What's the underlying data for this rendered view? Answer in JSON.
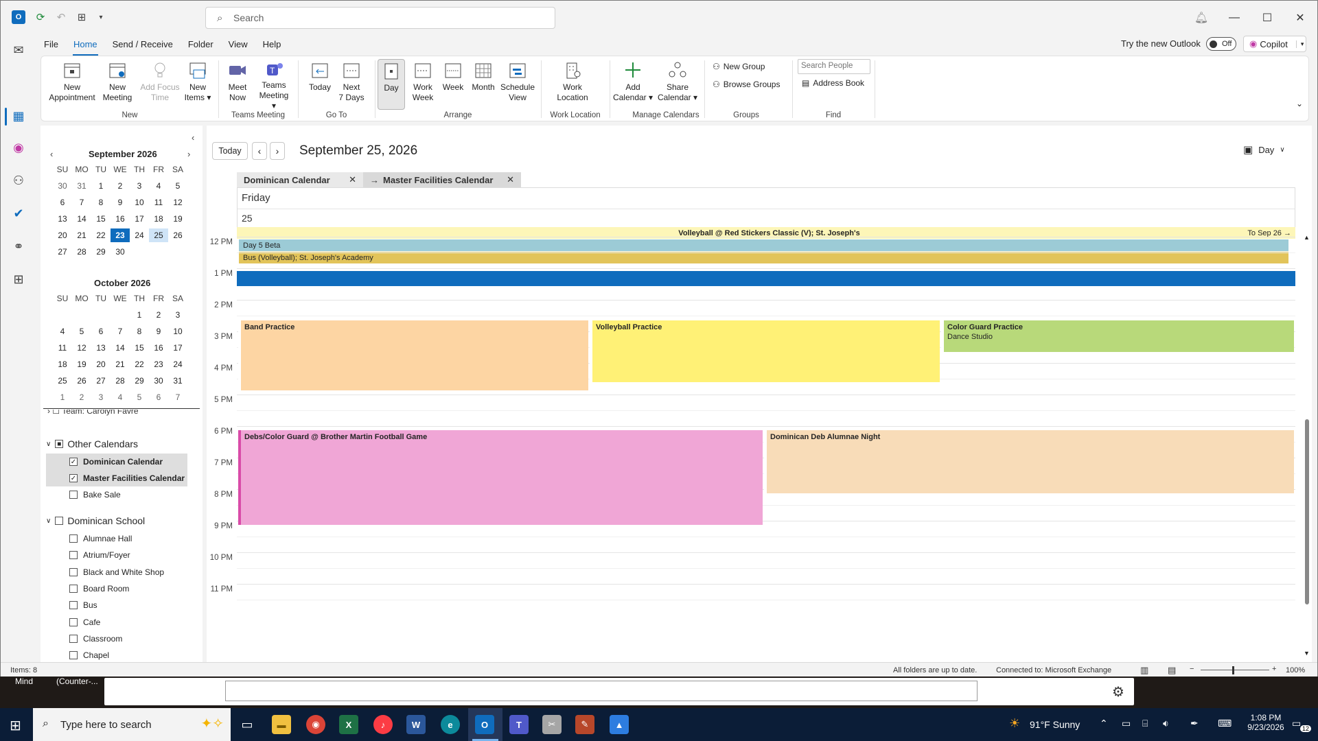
{
  "search": {
    "placeholder": "Search"
  },
  "menu": {
    "tabs": [
      "File",
      "Home",
      "Send / Receive",
      "Folder",
      "View",
      "Help"
    ]
  },
  "header_right": {
    "try_new": "Try the new Outlook",
    "toggle": "Off",
    "copilot": "Copilot"
  },
  "ribbon": {
    "new_appointment": [
      "New",
      "Appointment"
    ],
    "new_meeting": [
      "New",
      "Meeting"
    ],
    "add_focus_time": [
      "Add Focus",
      "Time"
    ],
    "new_items": [
      "New",
      "Items"
    ],
    "meet_now": [
      "Meet",
      "Now"
    ],
    "teams_meeting": [
      "Teams",
      "Meeting"
    ],
    "today": [
      "Today"
    ],
    "next7": [
      "Next",
      "7 Days"
    ],
    "day": [
      "Day"
    ],
    "work_week": [
      "Work",
      "Week"
    ],
    "week": [
      "Week"
    ],
    "month": [
      "Month"
    ],
    "schedule_view": [
      "Schedule",
      "View"
    ],
    "work_location": [
      "Work",
      "Location"
    ],
    "add_calendar": [
      "Add",
      "Calendar"
    ],
    "share_calendar": [
      "Share",
      "Calendar"
    ],
    "new_group": "New Group",
    "browse_groups": "Browse Groups",
    "search_people": "Search People",
    "address_book": "Address Book",
    "groups": {
      "new": "New",
      "teams": "Teams Meeting",
      "goto": "Go To",
      "arrange": "Arrange",
      "work_location": "Work Location",
      "manage": "Manage Calendars",
      "groups": "Groups",
      "find": "Find"
    }
  },
  "minical": {
    "dow": [
      "SU",
      "MO",
      "TU",
      "WE",
      "TH",
      "FR",
      "SA"
    ],
    "sept": {
      "title": "September 2026",
      "days": [
        "30",
        "31",
        "1",
        "2",
        "3",
        "4",
        "5",
        "6",
        "7",
        "8",
        "9",
        "10",
        "11",
        "12",
        "13",
        "14",
        "15",
        "16",
        "17",
        "18",
        "19",
        "20",
        "21",
        "22",
        "23",
        "24",
        "25",
        "26",
        "27",
        "28",
        "29",
        "30"
      ]
    },
    "oct": {
      "title": "October 2026",
      "days": [
        "",
        "",
        "",
        "",
        "1",
        "2",
        "3",
        "4",
        "5",
        "6",
        "7",
        "8",
        "9",
        "10",
        "11",
        "12",
        "13",
        "14",
        "15",
        "16",
        "17",
        "18",
        "19",
        "20",
        "21",
        "22",
        "23",
        "24",
        "25",
        "26",
        "27",
        "28",
        "29",
        "30",
        "31",
        "1",
        "2",
        "3",
        "4",
        "5",
        "6",
        "7"
      ]
    }
  },
  "folders": {
    "partial": "Team: Carolyn Favre",
    "other_calendars": "Other Calendars",
    "other_items": [
      {
        "label": "Dominican Calendar",
        "checked": true
      },
      {
        "label": "Master Facilities Calendar",
        "checked": true
      },
      {
        "label": "Bake Sale",
        "checked": false
      }
    ],
    "dominican_school": "Dominican School",
    "school_items": [
      "Alumnae Hall",
      "Atrium/Foyer",
      "Black and White Shop",
      "Board Room",
      "Bus",
      "Cafe",
      "Classroom",
      "Chapel"
    ]
  },
  "dayview": {
    "today_btn": "Today",
    "date_title": "September 25, 2026",
    "view": "Day",
    "tabs": [
      "Dominican Calendar",
      "Master Facilities Calendar"
    ],
    "day_name": "Friday",
    "day_num": "25",
    "allday": {
      "volleyball": "Volleyball @ Red Stickers Classic (V); St. Joseph's",
      "to_sep": "To Sep 26",
      "day5": "Day 5 Beta",
      "bus": "Bus (Volleyball); St. Joseph's Academy"
    },
    "hours": [
      "12 PM",
      "1 PM",
      "2 PM",
      "3 PM",
      "4 PM",
      "5 PM",
      "6 PM",
      "7 PM",
      "8 PM",
      "9 PM",
      "10 PM",
      "11 PM"
    ],
    "events": {
      "band": "Band Practice",
      "volleyball_practice": "Volleyball Practice",
      "color_guard": "Color Guard Practice",
      "color_guard_loc": "Dance Studio",
      "debs": "Debs/Color Guard @ Brother Martin Football Game",
      "alumnae": "Dominican Deb Alumnae Night"
    }
  },
  "status": {
    "items": "Items: 8",
    "uptodate": "All folders are up to date.",
    "connected": "Connected to: Microsoft Exchange",
    "zoom": "100%"
  },
  "behind": {
    "a": "Mind",
    "b": "(Counter-..."
  },
  "taskbar": {
    "search": "Type here to search",
    "weather": "91°F  Sunny",
    "time": "1:08 PM",
    "date": "9/23/2026",
    "notif": "12"
  },
  "colors": {
    "accent": "#0f6cbd",
    "band": "#fdd5a3",
    "volleyball": "#fff176",
    "colorguard": "#b8d97a",
    "debs": "#f0a6d6",
    "alumnae": "#f8dcb8"
  }
}
